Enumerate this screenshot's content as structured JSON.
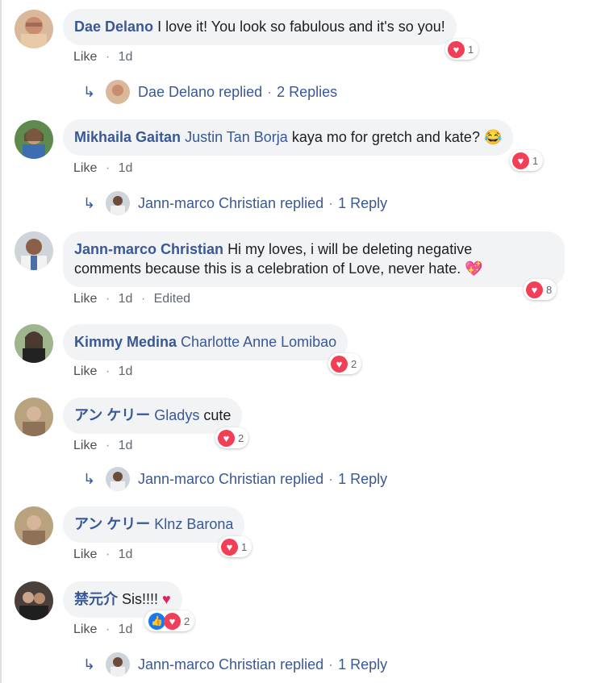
{
  "comments": [
    {
      "author": "Dae Delano",
      "mention": "",
      "text": "I love it! You look so fabulous and it's so you!",
      "line2": "",
      "emoji": "",
      "like_label": "Like",
      "time": "1d",
      "edited": "",
      "reaction_count": "1",
      "reply": {
        "name": "Dae Delano",
        "verb": "replied",
        "count": "2 Replies"
      }
    },
    {
      "author": "Mikhaila Gaitan",
      "mention": "Justin Tan Borja",
      "text": "kaya mo for gretch and kate?",
      "line2": "",
      "emoji": "😂",
      "like_label": "Like",
      "time": "1d",
      "edited": "",
      "reaction_count": "1",
      "reply": {
        "name": "Jann-marco Christian",
        "verb": "replied",
        "count": "1 Reply"
      }
    },
    {
      "author": "Jann-marco Christian",
      "mention": "",
      "text": "Hi my loves, i will be deleting negative",
      "line2": "comments because this is a celebration of Love, never hate.",
      "emoji": "💖",
      "like_label": "Like",
      "time": "1d",
      "edited": "Edited",
      "reaction_count": "8",
      "reply": null
    },
    {
      "author": "Kimmy Medina",
      "mention": "Charlotte Anne Lomibao",
      "text": "",
      "line2": "",
      "emoji": "",
      "like_label": "Like",
      "time": "1d",
      "edited": "",
      "reaction_count": "2",
      "reply": null
    },
    {
      "author": "アン ケリー",
      "mention": "Gladys",
      "text": "cute",
      "line2": "",
      "emoji": "",
      "like_label": "Like",
      "time": "1d",
      "edited": "",
      "reaction_count": "2",
      "reply": {
        "name": "Jann-marco Christian",
        "verb": "replied",
        "count": "1 Reply"
      }
    },
    {
      "author": "アン ケリー",
      "mention": "Klnz Barona",
      "text": "",
      "line2": "",
      "emoji": "",
      "like_label": "Like",
      "time": "1d",
      "edited": "",
      "reaction_count": "1",
      "reply": null
    },
    {
      "author": "禁元介",
      "mention": "",
      "text": "Sis!!!!",
      "line2": "",
      "emoji": "♥",
      "like_label": "Like",
      "time": "1d",
      "edited": "",
      "reaction_count": "2",
      "reply": {
        "name": "Jann-marco Christian",
        "verb": "replied",
        "count": "1 Reply"
      }
    }
  ],
  "separator": "·",
  "colors": {
    "link": "#385898",
    "bubble": "#f2f3f5",
    "love": "#f33e58",
    "like": "#1877f2"
  }
}
